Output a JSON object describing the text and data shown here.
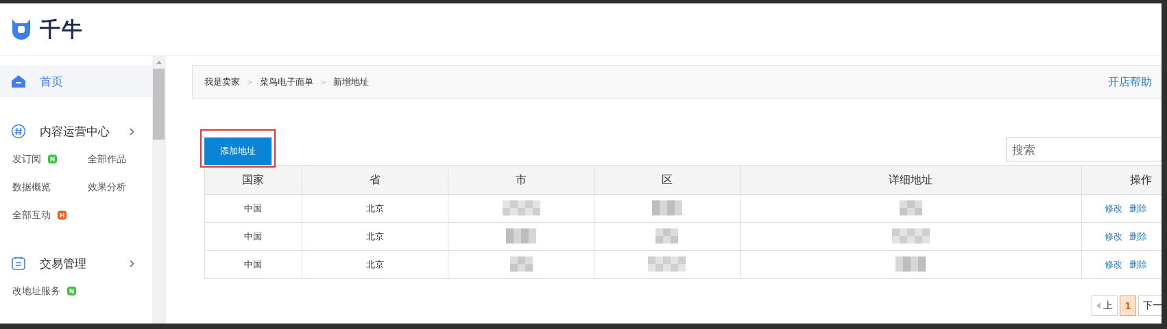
{
  "header": {
    "logo_text": "千牛"
  },
  "sidebar": {
    "items": [
      {
        "label": "首页",
        "selected": true,
        "kind": "home"
      }
    ],
    "sections": [
      {
        "title": "内容运营中心",
        "kind": "content",
        "links": [
          {
            "label": "发订阅",
            "badge": {
              "text": "N",
              "color": "#3cc23c"
            }
          },
          {
            "label": "全部作品"
          },
          {
            "label": "数据概览"
          },
          {
            "label": "效果分析"
          },
          {
            "label": "全部互动",
            "badge": {
              "text": "H",
              "color": "#f5581f"
            }
          }
        ]
      },
      {
        "title": "交易管理",
        "kind": "trade",
        "links": [
          {
            "label": "改地址服务",
            "badge": {
              "text": "N",
              "color": "#3cc23c"
            }
          }
        ]
      }
    ]
  },
  "breadcrumb": {
    "items": [
      "我是卖家",
      "菜鸟电子面单",
      "新增地址"
    ],
    "separator": ">",
    "help_link": "开店帮助"
  },
  "add_button": "添加地址",
  "search": {
    "placeholder": "搜索"
  },
  "table": {
    "columns": [
      "国家",
      "省",
      "市",
      "区",
      "详细地址",
      "操作"
    ],
    "rows": [
      {
        "cells": [
          {
            "kind": "text",
            "text": "中国"
          },
          {
            "kind": "text",
            "text": "北京"
          },
          {
            "kind": "redacted"
          },
          {
            "kind": "redacted"
          },
          {
            "kind": "redacted"
          }
        ],
        "actions": [
          "修改",
          "删除"
        ]
      },
      {
        "cells": [
          {
            "kind": "text",
            "text": "中国"
          },
          {
            "kind": "text",
            "text": "北京"
          },
          {
            "kind": "redacted"
          },
          {
            "kind": "redacted"
          },
          {
            "kind": "redacted"
          }
        ],
        "actions": [
          "修改",
          "删除"
        ]
      },
      {
        "cells": [
          {
            "kind": "text",
            "text": "中国"
          },
          {
            "kind": "text",
            "text": "北京"
          },
          {
            "kind": "redacted"
          },
          {
            "kind": "redacted"
          },
          {
            "kind": "redacted"
          }
        ],
        "actions": [
          "修改",
          "删除"
        ]
      }
    ]
  },
  "pagination": {
    "prev": "上",
    "pages": [
      {
        "label": "1",
        "selected": true
      }
    ],
    "next": "下一"
  }
}
